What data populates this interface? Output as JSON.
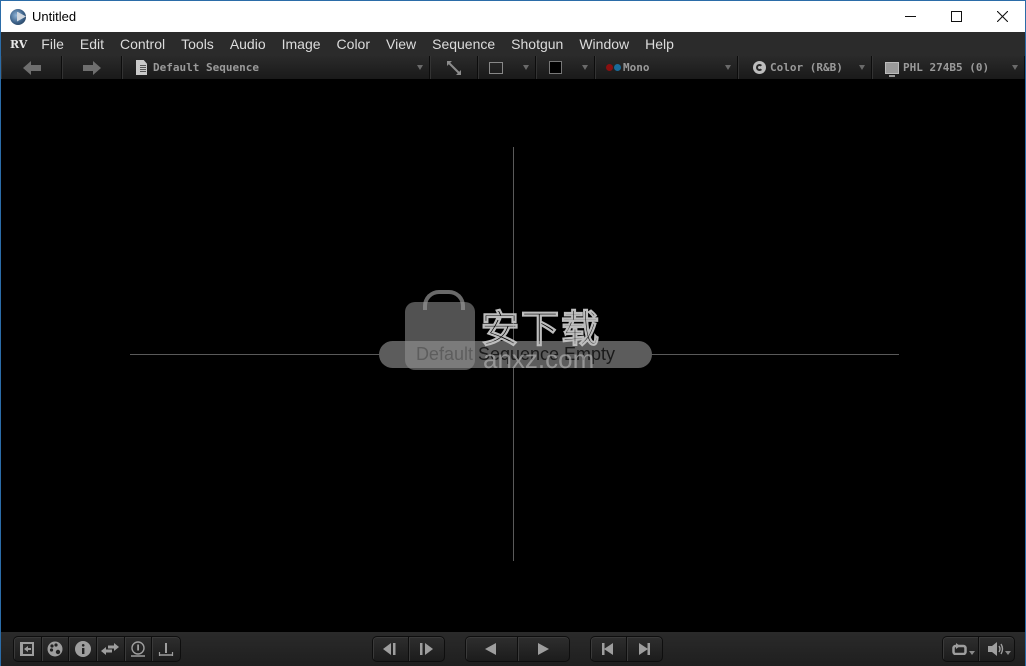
{
  "window": {
    "title": "Untitled",
    "controls": {
      "minimize": "minimize-icon",
      "maximize": "maximize-icon",
      "close": "close-icon"
    }
  },
  "menubar": {
    "logo": "RV",
    "items": [
      "File",
      "Edit",
      "Control",
      "Tools",
      "Audio",
      "Image",
      "Color",
      "View",
      "Sequence",
      "Shotgun",
      "Window",
      "Help"
    ]
  },
  "toolbar": {
    "back_icon": "arrow-left-icon",
    "forward_icon": "arrow-right-icon",
    "source_select": "Default Sequence",
    "channel_select": "Mono",
    "color_select": "Color (R&B)",
    "display_select": "PHL 274B5 (0)"
  },
  "viewer": {
    "empty_message": "Default Sequence Empty",
    "watermark_text": "安下载",
    "watermark_sub": "anxz.com"
  },
  "bottombar": {
    "left_tools": [
      "exit-fullscreen-icon",
      "palette-icon",
      "info-icon",
      "swap-icon",
      "stereo-icon",
      "timeline-icon"
    ],
    "step_buttons": [
      "step-back-icon",
      "step-forward-icon"
    ],
    "play_buttons": [
      "play-backward-icon",
      "play-forward-icon"
    ],
    "jump_buttons": [
      "jump-start-icon",
      "jump-end-icon"
    ],
    "right_tools": [
      "loop-mode-icon",
      "volume-icon"
    ]
  },
  "colors": {
    "accent_border": "#2b6ca8",
    "menubar_bg": "#2b2b2b",
    "viewer_bg": "#000000",
    "channel_dot_red": "#8a1010",
    "channel_dot_blue": "#1a6b9a"
  }
}
